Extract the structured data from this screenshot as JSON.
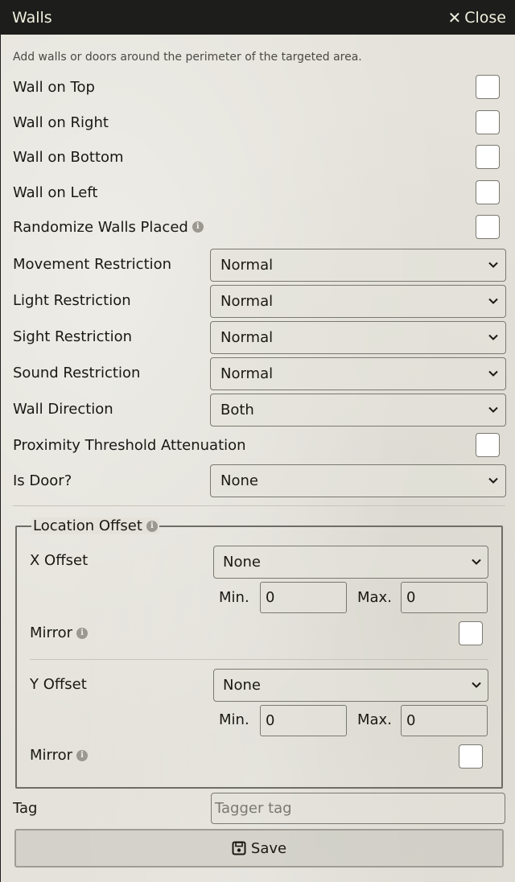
{
  "header": {
    "title": "Walls",
    "close_label": "Close"
  },
  "hint": "Add walls or doors around the perimeter of the targeted area.",
  "checkbox_rows": [
    {
      "label": "Wall on Top",
      "checked": false
    },
    {
      "label": "Wall on Right",
      "checked": false
    },
    {
      "label": "Wall on Bottom",
      "checked": false
    },
    {
      "label": "Wall on Left",
      "checked": false
    },
    {
      "label": "Randomize Walls Placed",
      "checked": false
    }
  ],
  "select_rows": [
    {
      "label": "Movement Restriction",
      "value": "Normal"
    },
    {
      "label": "Light Restriction",
      "value": "Normal"
    },
    {
      "label": "Sight Restriction",
      "value": "Normal"
    },
    {
      "label": "Sound Restriction",
      "value": "Normal"
    },
    {
      "label": "Wall Direction",
      "value": "Both"
    }
  ],
  "proximity": {
    "label": "Proximity Threshold Attenuation",
    "checked": false
  },
  "door": {
    "label": "Is Door?",
    "value": "None"
  },
  "location_offset": {
    "legend": "Location Offset",
    "x": {
      "label": "X Offset",
      "value": "None",
      "min_label": "Min.",
      "min": "0",
      "max_label": "Max.",
      "max": "0",
      "mirror_label": "Mirror"
    },
    "y": {
      "label": "Y Offset",
      "value": "None",
      "min_label": "Min.",
      "min": "0",
      "max_label": "Max.",
      "max": "0",
      "mirror_label": "Mirror"
    }
  },
  "tag": {
    "label": "Tag",
    "placeholder": "Tagger tag"
  },
  "save_label": "Save",
  "icons": {
    "close": "close-icon",
    "info": "info-icon",
    "chevron": "chevron-down-icon",
    "save": "floppy-disk-icon"
  }
}
